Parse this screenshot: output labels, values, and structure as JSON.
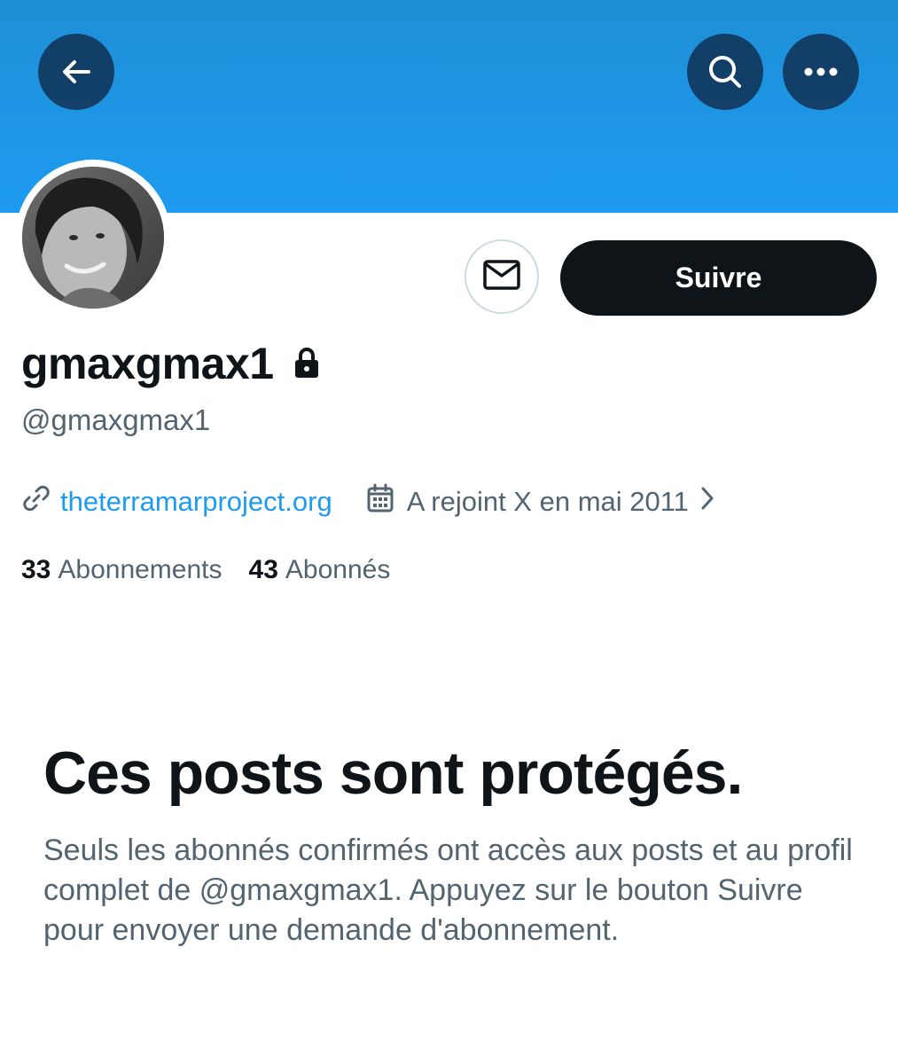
{
  "header": {
    "back_icon": "arrow-left-icon",
    "search_icon": "search-icon",
    "more_icon": "more-horizontal-icon",
    "banner_color": "#1d9bf0"
  },
  "profile": {
    "display_name": "gmaxgmax1",
    "handle": "@gmaxgmax1",
    "protected_icon": "lock-icon",
    "website": "theterramarproject.org",
    "joined": "A rejoint X en mai 2011",
    "following_count": "33",
    "following_label": "Abonnements",
    "followers_count": "43",
    "followers_label": "Abonnés"
  },
  "actions": {
    "message_icon": "envelope-icon",
    "follow_label": "Suivre"
  },
  "protected_notice": {
    "title": "Ces posts sont protégés.",
    "description": "Seuls les abonnés confirmés ont accès aux posts et au profil complet de @gmaxgmax1. Appuyez sur le bouton Suivre pour envoyer une demande d'abonnement."
  }
}
